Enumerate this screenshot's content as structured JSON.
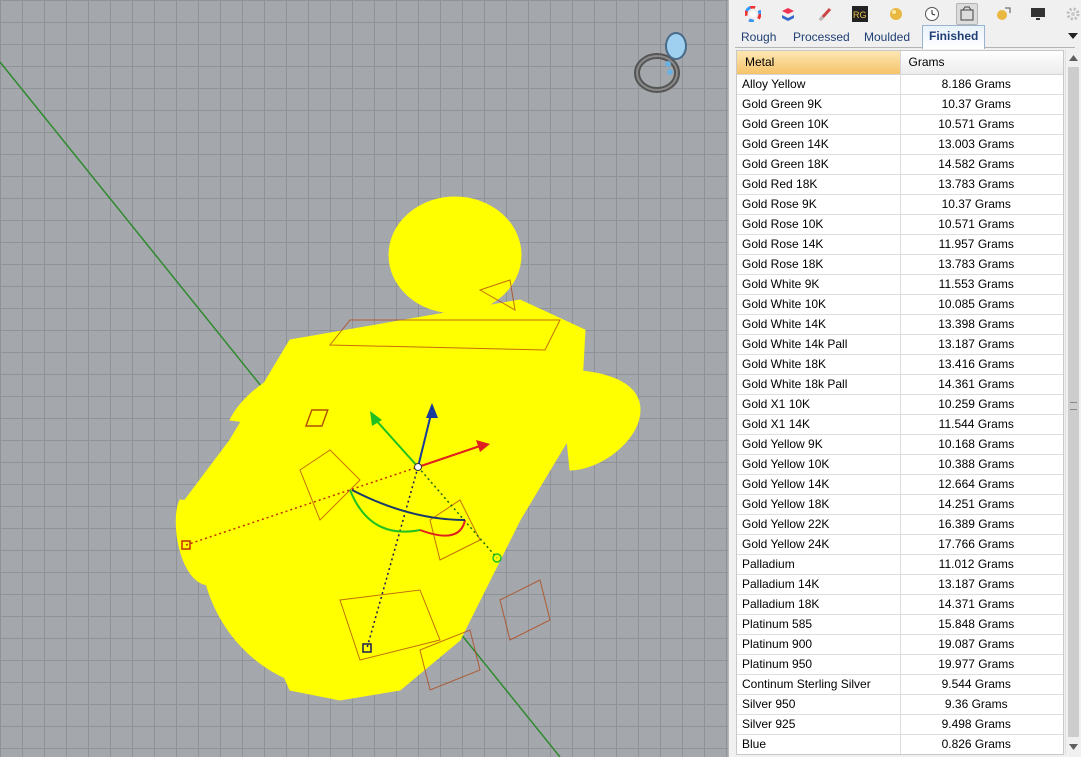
{
  "viewport": {
    "name": "Perspective viewport",
    "object_color": "#ffff00",
    "grid_color": "#a4a8ac",
    "axis_color": "#2f8a2f"
  },
  "toolbar": {
    "icons": [
      {
        "name": "color-wheel-icon",
        "active": false
      },
      {
        "name": "layers-icon",
        "active": false
      },
      {
        "name": "brush-icon",
        "active": false
      },
      {
        "name": "rg-logo-icon",
        "active": false
      },
      {
        "name": "gold-sphere-icon",
        "active": false
      },
      {
        "name": "clock-icon",
        "active": false
      },
      {
        "name": "ring-weight-icon",
        "active": true
      },
      {
        "name": "render-icon",
        "active": false
      },
      {
        "name": "monitor-icon",
        "active": false
      },
      {
        "name": "settings-icon",
        "active": false
      }
    ]
  },
  "tabs": [
    {
      "label": "Rough",
      "active": false
    },
    {
      "label": "Processed",
      "active": false
    },
    {
      "label": "Moulded",
      "active": false
    },
    {
      "label": "Finished",
      "active": true
    }
  ],
  "table": {
    "headers": {
      "metal": "Metal",
      "grams": "Grams"
    },
    "rows": [
      {
        "metal": "Alloy Yellow",
        "grams": "8.186 Grams"
      },
      {
        "metal": "Gold Green 9K",
        "grams": "10.37 Grams"
      },
      {
        "metal": "Gold Green 10K",
        "grams": "10.571 Grams"
      },
      {
        "metal": "Gold Green 14K",
        "grams": "13.003 Grams"
      },
      {
        "metal": "Gold Green 18K",
        "grams": "14.582 Grams"
      },
      {
        "metal": "Gold Red 18K",
        "grams": "13.783 Grams"
      },
      {
        "metal": "Gold Rose 9K",
        "grams": "10.37 Grams"
      },
      {
        "metal": "Gold Rose 10K",
        "grams": "10.571 Grams"
      },
      {
        "metal": "Gold Rose 14K",
        "grams": "11.957 Grams"
      },
      {
        "metal": "Gold Rose 18K",
        "grams": "13.783 Grams"
      },
      {
        "metal": "Gold White 9K",
        "grams": "11.553 Grams"
      },
      {
        "metal": "Gold White 10K",
        "grams": "10.085 Grams"
      },
      {
        "metal": "Gold White 14K",
        "grams": "13.398 Grams"
      },
      {
        "metal": "Gold White 14k Pall",
        "grams": "13.187 Grams"
      },
      {
        "metal": "Gold White 18K",
        "grams": "13.416 Grams"
      },
      {
        "metal": "Gold White 18k Pall",
        "grams": "14.361 Grams"
      },
      {
        "metal": "Gold X1 10K",
        "grams": "10.259 Grams"
      },
      {
        "metal": "Gold X1 14K",
        "grams": "11.544 Grams"
      },
      {
        "metal": "Gold Yellow 9K",
        "grams": "10.168 Grams"
      },
      {
        "metal": "Gold Yellow 10K",
        "grams": "10.388 Grams"
      },
      {
        "metal": "Gold Yellow 14K",
        "grams": "12.664 Grams"
      },
      {
        "metal": "Gold Yellow 18K",
        "grams": "14.251 Grams"
      },
      {
        "metal": "Gold Yellow 22K",
        "grams": "16.389 Grams"
      },
      {
        "metal": "Gold Yellow 24K",
        "grams": "17.766 Grams"
      },
      {
        "metal": "Palladium",
        "grams": "11.012 Grams"
      },
      {
        "metal": "Palladium 14K",
        "grams": "13.187 Grams"
      },
      {
        "metal": "Palladium 18K",
        "grams": "14.371 Grams"
      },
      {
        "metal": "Platinum 585",
        "grams": "15.848 Grams"
      },
      {
        "metal": "Platinum 900",
        "grams": "19.087 Grams"
      },
      {
        "metal": "Platinum 950",
        "grams": "19.977 Grams"
      },
      {
        "metal": "Continum Sterling Silver",
        "grams": "9.544 Grams"
      },
      {
        "metal": "Silver 950",
        "grams": "9.36 Grams"
      },
      {
        "metal": "Silver 925",
        "grams": "9.498 Grams"
      },
      {
        "metal": "Blue",
        "grams": "0.826 Grams"
      }
    ]
  }
}
